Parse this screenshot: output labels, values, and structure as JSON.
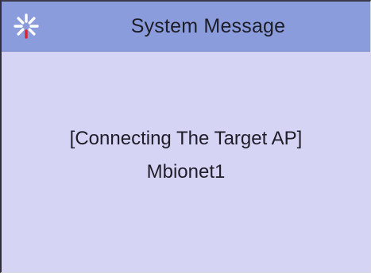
{
  "dialog": {
    "title": "System Message",
    "icon": "loading-spinner-icon",
    "message_line1": "[Connecting The Target AP]",
    "message_line2": "Mbionet1"
  },
  "colors": {
    "title_bar": "#8a9cdc",
    "body": "#d6d4f5",
    "text": "#1e1e28",
    "spinner_active": "#e0202a",
    "spinner_inactive": "#ffffff"
  }
}
